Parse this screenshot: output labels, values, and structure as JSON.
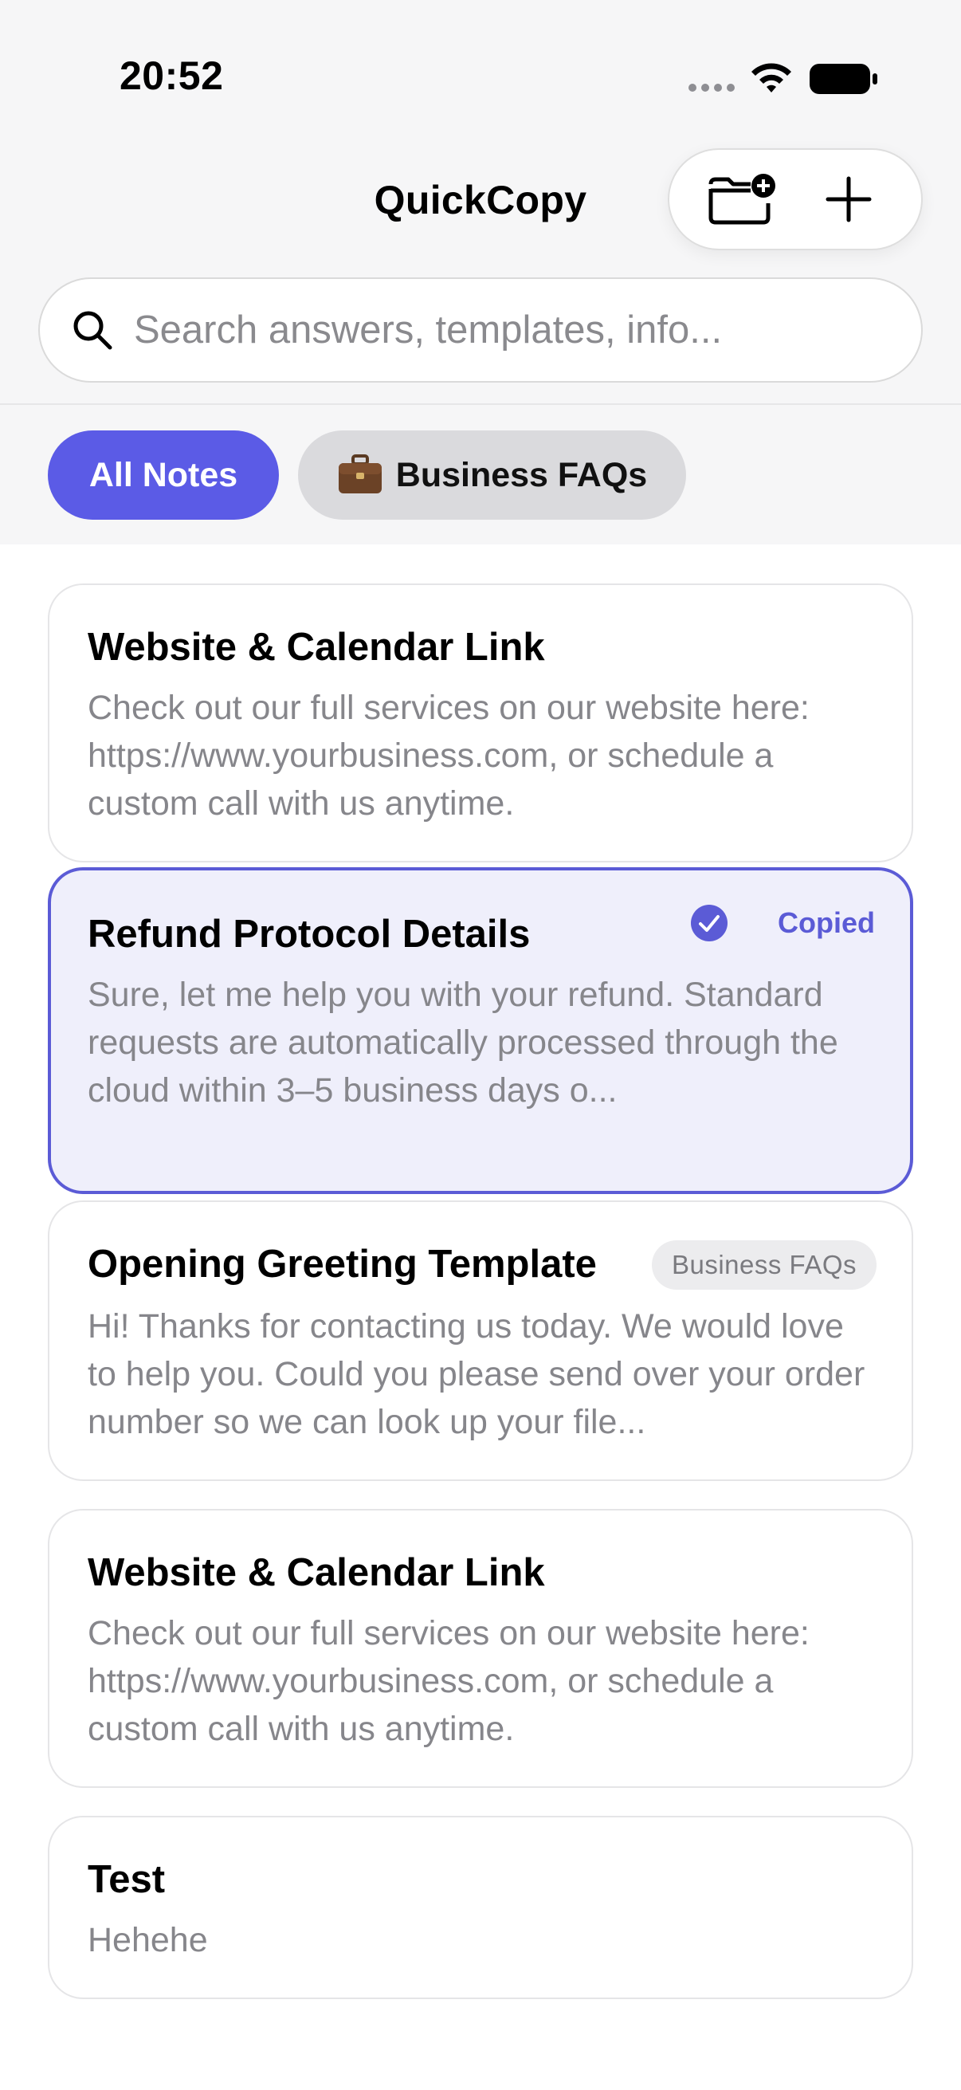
{
  "status_bar": {
    "time": "20:52"
  },
  "header": {
    "title": "QuickCopy",
    "new_folder_icon": "folder-plus-icon",
    "add_icon": "plus-icon"
  },
  "search": {
    "placeholder": "Search answers, templates, info...",
    "value": ""
  },
  "filters": [
    {
      "label": "All Notes",
      "selected": true
    },
    {
      "label": "Business FAQs",
      "icon": "briefcase-icon",
      "selected": false
    }
  ],
  "notes": [
    {
      "title": "Website & Calendar Link",
      "body": "Check out our full services on our website here: https://www.yourbusiness.com, or schedule a custom call with us anytime."
    },
    {
      "title": "Refund Protocol Details",
      "body": "Sure, let me help you with your refund. Standard requests are automatically processed through the cloud within 3–5 business days o...",
      "status": "Copied"
    },
    {
      "title": "Opening Greeting Template",
      "body": "Hi! Thanks for contacting us today. We would love to help you. Could you please send over your order number so we can look up your file...",
      "tag": "Business FAQs"
    },
    {
      "title": "Website & Calendar Link",
      "body": "Check out our full services on our website here: https://www.yourbusiness.com, or schedule a custom call with us anytime."
    },
    {
      "title": "Test",
      "body": "Hehehe"
    }
  ],
  "colors": {
    "accent": "#5b5be6",
    "copied_border": "#5b5bd6",
    "copied_background": "#efeffb",
    "chip_inactive": "#dadadd",
    "muted_text": "#86868b"
  }
}
